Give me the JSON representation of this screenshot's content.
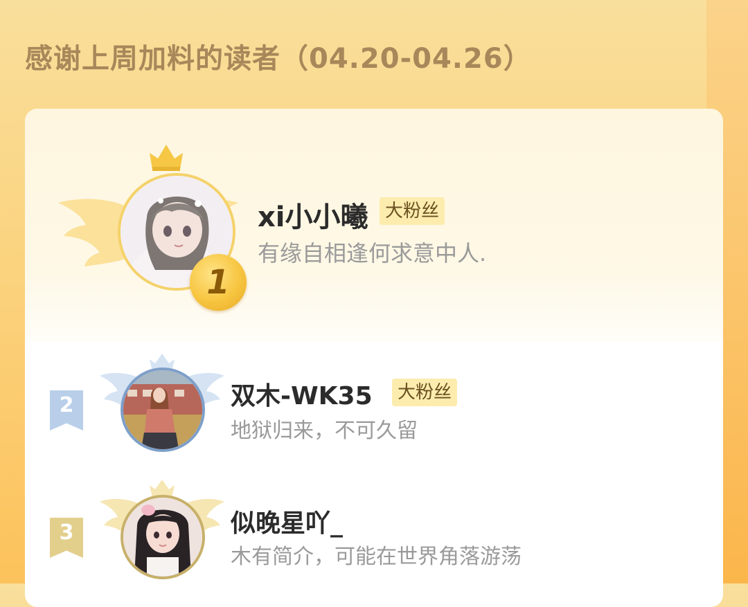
{
  "header": {
    "title": "感谢上周加料的读者（04.20-04.26）"
  },
  "readers": [
    {
      "rank": "1",
      "name": "xi小小曦",
      "badge": "大粉丝",
      "bio": "有缘自相逢何求意中人."
    },
    {
      "rank": "2",
      "name": "双木-WK35",
      "badge": "大粉丝",
      "bio": "地狱归来，不可久留"
    },
    {
      "rank": "3",
      "name": "似晚星吖_",
      "bio": "木有简介，可能在世界角落游荡"
    }
  ],
  "colors": {
    "background": "#fbd37f",
    "title": "#a8875a",
    "badge_bg": "#fcecae",
    "gold": "#f7c540",
    "silver_blue": "#b9cfe9",
    "bronze": "#e3cf8c"
  },
  "icons": [
    "crown-icon",
    "wings-icon",
    "medal-icon",
    "rank-flag-icon"
  ]
}
